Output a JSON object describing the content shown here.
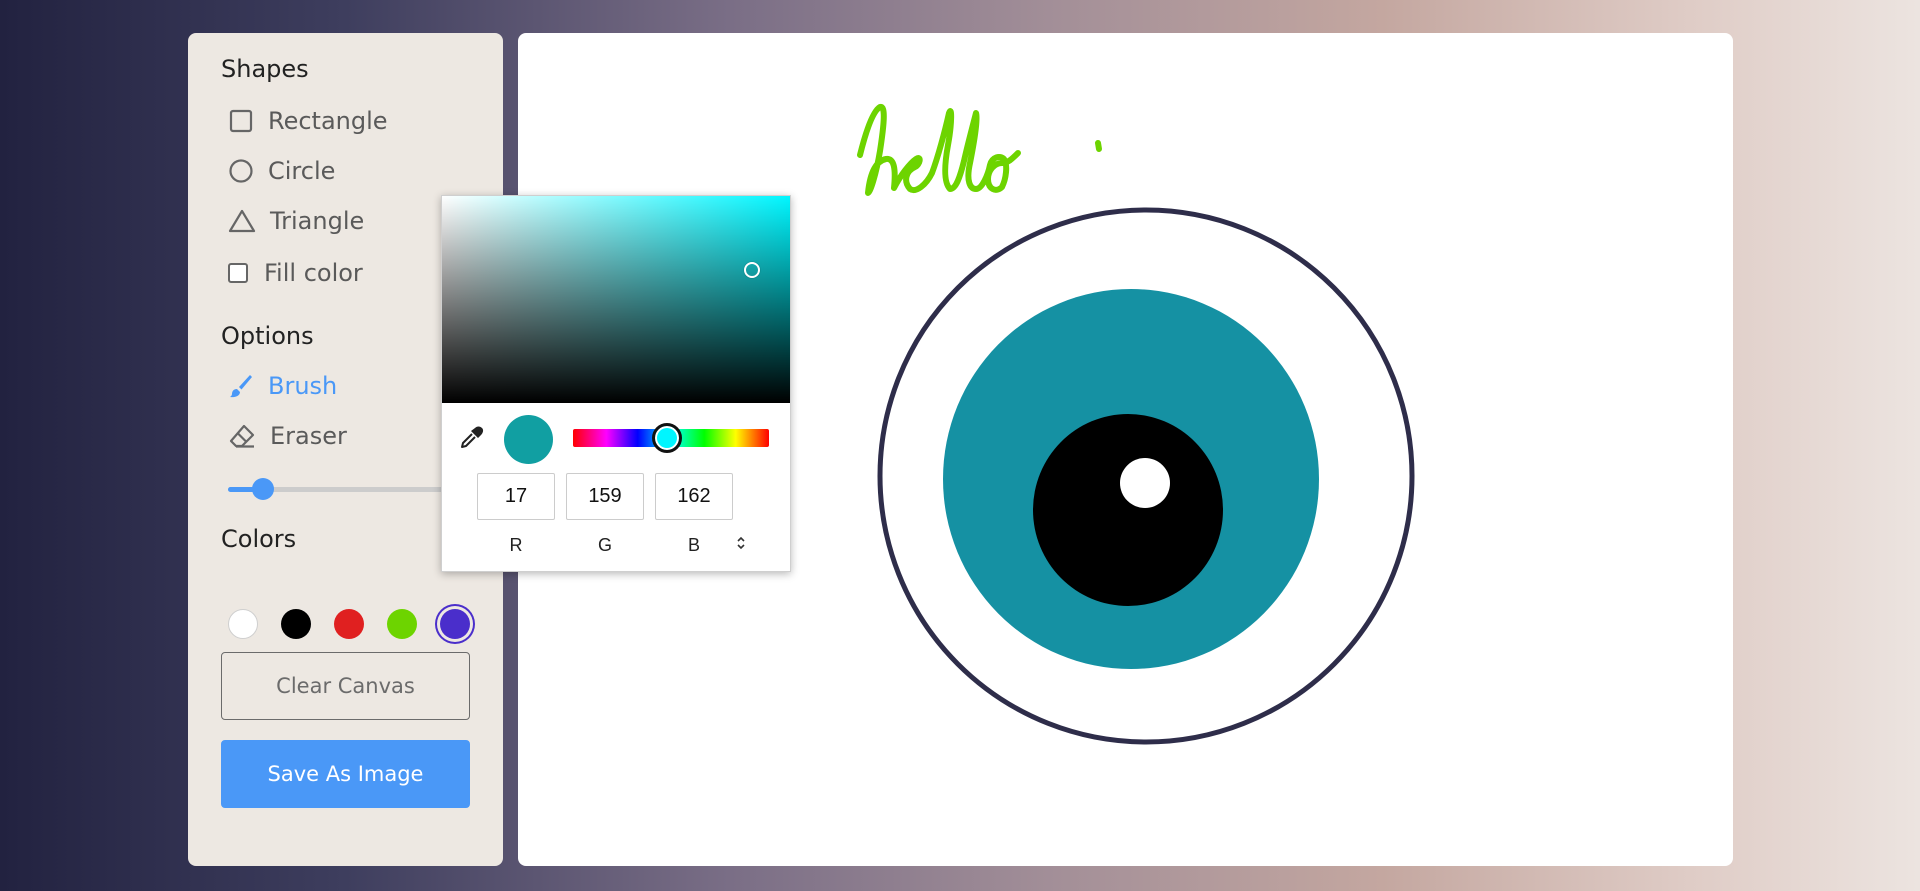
{
  "tools": {
    "shapes_title": "Shapes",
    "shapes": [
      {
        "label": "Rectangle",
        "icon": "square-outline-icon"
      },
      {
        "label": "Circle",
        "icon": "circle-outline-icon"
      },
      {
        "label": "Triangle",
        "icon": "triangle-outline-icon"
      }
    ],
    "fill_color_label": "Fill color",
    "fill_color_checked": false,
    "options_title": "Options",
    "brush_label": "Brush",
    "eraser_label": "Eraser",
    "brush_size_fraction": 0.14,
    "colors_title": "Colors",
    "colors": [
      "#ffffff",
      "#000000",
      "#e02020",
      "#6dd400",
      "#4a2ecb"
    ],
    "selected_color_index": 4,
    "clear_label": "Clear Canvas",
    "save_label": "Save As Image",
    "accent_color": "#4a98f7"
  },
  "canvas": {
    "handwriting": "hello",
    "handwriting_color": "#6dd400",
    "outer_circle_stroke": "#2e2d4a",
    "iris_color": "#1591a3",
    "pupil_color": "#000000",
    "highlight_color": "#ffffff"
  },
  "color_picker": {
    "hue_color": "#00f6ff",
    "current_color": "#119fa2",
    "r": "17",
    "g": "159",
    "b": "162",
    "r_label": "R",
    "g_label": "G",
    "b_label": "B",
    "mode_toggle_glyph": "⌃⌄"
  }
}
